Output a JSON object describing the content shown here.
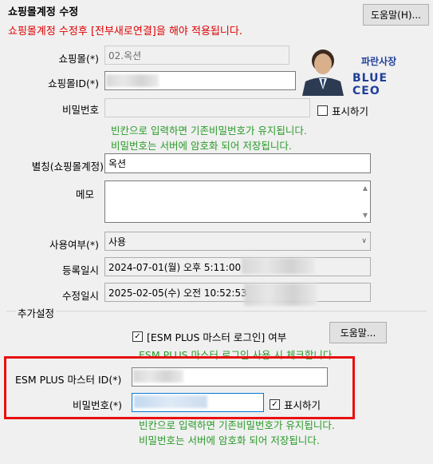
{
  "header": {
    "title": "쇼핑몰계정 수정",
    "warning": "쇼핑몰계정 수정후 [전부새로연결]을 해야 적용됩니다.",
    "help_label": "도움말(H)..."
  },
  "brand": {
    "line1": "파란사장",
    "line2": "BLUE CEO"
  },
  "form": {
    "mall_label": "쇼핑몰(*)",
    "mall_value": "02.옥션",
    "mall_id_label": "쇼핑몰ID(*)",
    "password_label": "비밀번호",
    "show_label": "표시하기",
    "password_hint1": "빈칸으로 입력하면 기존비밀번호가 유지됩니다.",
    "password_hint2": "비밀번호는 서버에 암호화 되어 저장됩니다.",
    "alias_label": "별칭(쇼핑몰계정)",
    "alias_value": "옥션",
    "memo_label": "메모",
    "use_label": "사용여부(*)",
    "use_value": "사용",
    "reg_label": "등록일시",
    "reg_value": "2024-07-01(월) 오후 5:11:00",
    "mod_label": "수정일시",
    "mod_value": "2025-02-05(수) 오전 10:52:53"
  },
  "extra": {
    "group_title": "추가설정",
    "esm_check_label": "[ESM PLUS 마스터 로그인] 여부",
    "esm_check_checked": true,
    "help_label": "도움말...",
    "esm_hint": "ESM PLUS 마스터 로그인 사용 시 체크합니다.",
    "esm_id_label": "ESM PLUS 마스터 ID(*)",
    "esm_pw_label": "비밀번호(*)",
    "show_label": "표시하기",
    "show_checked": true,
    "pw_hint1": "빈칸으로 입력하면 기존비밀번호가 유지됩니다.",
    "pw_hint2": "비밀번호는 서버에 암호화 되어 저장됩니다."
  },
  "colors": {
    "warning": "#e00000",
    "hint": "#2a9a2a",
    "highlight": "#e81010",
    "brand_blue": "#1f3f9a"
  }
}
